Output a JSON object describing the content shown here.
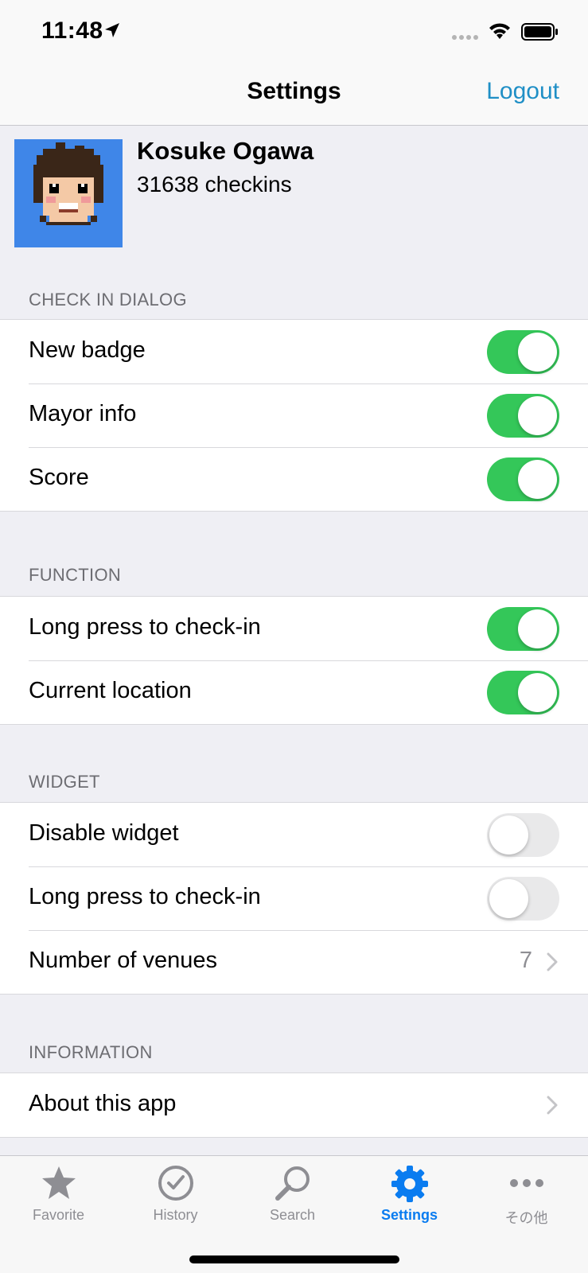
{
  "status": {
    "time": "11:48"
  },
  "nav": {
    "title": "Settings",
    "logout_label": "Logout"
  },
  "profile": {
    "name": "Kosuke Ogawa",
    "checkins": "31638 checkins"
  },
  "sections": {
    "check_in_dialog": {
      "header": "CHECK IN DIALOG",
      "rows": [
        {
          "label": "New badge",
          "on": true
        },
        {
          "label": "Mayor info",
          "on": true
        },
        {
          "label": "Score",
          "on": true
        }
      ]
    },
    "function": {
      "header": "FUNCTION",
      "rows": [
        {
          "label": "Long press to check-in",
          "on": true
        },
        {
          "label": "Current location",
          "on": true
        }
      ]
    },
    "widget": {
      "header": "WIDGET",
      "rows": [
        {
          "label": "Disable widget",
          "on": false
        },
        {
          "label": "Long press to check-in",
          "on": false
        },
        {
          "label": "Number of venues",
          "value": "7"
        }
      ]
    },
    "information": {
      "header": "INFORMATION",
      "rows": [
        {
          "label": "About this app"
        }
      ]
    }
  },
  "tabs": [
    {
      "label": "Favorite",
      "icon": "star-icon",
      "active": false
    },
    {
      "label": "History",
      "icon": "clock-icon",
      "active": false
    },
    {
      "label": "Search",
      "icon": "magnifier-icon",
      "active": false
    },
    {
      "label": "Settings",
      "icon": "gear-icon",
      "active": true
    },
    {
      "label": "その他",
      "icon": "more-dots-icon",
      "active": false
    }
  ],
  "colors": {
    "accent": "#1f8fc6",
    "toggle_on": "#34c759",
    "tab_active": "#0a7cf0",
    "avatar_bg": "#3f86e8"
  }
}
